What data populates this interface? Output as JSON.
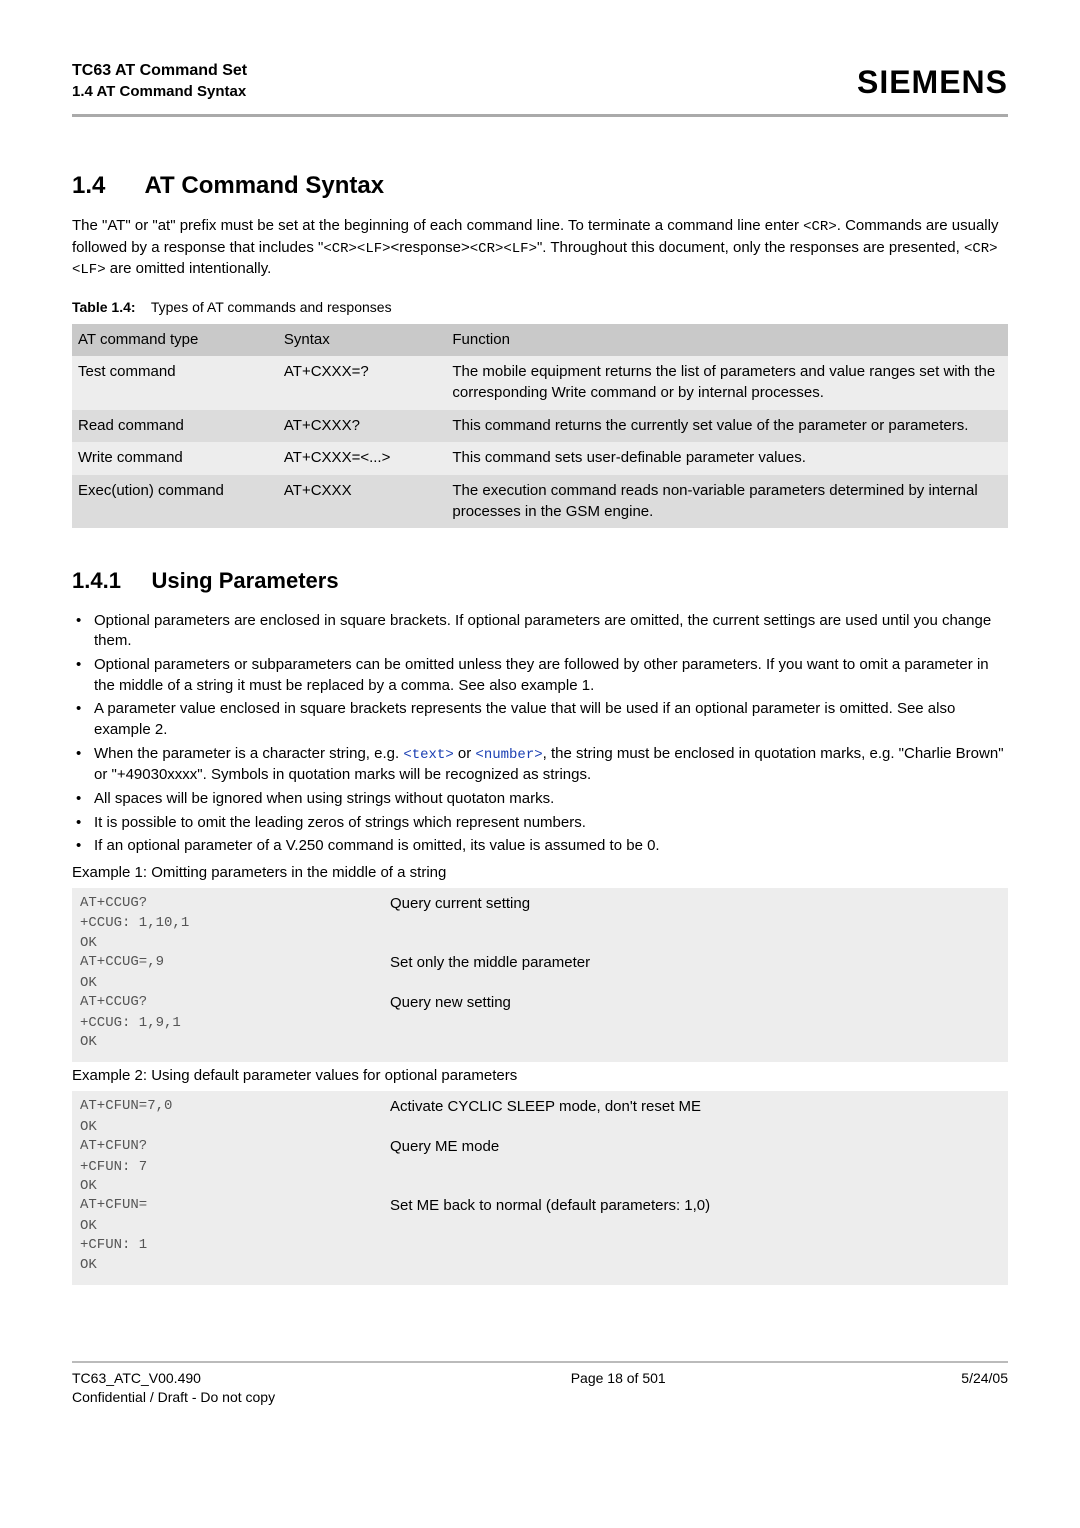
{
  "header": {
    "title": "TC63 AT Command Set",
    "subtitle": "1.4 AT Command Syntax",
    "logo": "SIEMENS"
  },
  "section14": {
    "num": "1.4",
    "title": "AT Command Syntax",
    "intro_part1": "The \"AT\" or \"at\" prefix must be set at the beginning of each command line. To terminate a command line enter ",
    "cr1": "<CR>",
    "intro_part2": ". Commands are usually followed by a response that includes \"",
    "crlf1": "<CR><LF>",
    "resp": "<response>",
    "crlf2": "<CR><LF>",
    "intro_part3": "\". Throughout this document, only the responses are presented, ",
    "crlf3": "<CR><LF>",
    "intro_part4": " are omitted intentionally."
  },
  "table14": {
    "label": "Table 1.4:",
    "caption": "Types of AT commands and responses",
    "headers": [
      "AT command type",
      "Syntax",
      "Function"
    ],
    "rows": [
      {
        "type": "Test command",
        "syntax": "AT+CXXX=?",
        "func": "The mobile equipment returns the list of parameters and value ranges set with the corresponding Write command or by internal processes."
      },
      {
        "type": "Read command",
        "syntax": "AT+CXXX?",
        "func": "This command returns the currently set value of the parameter or parameters."
      },
      {
        "type": "Write command",
        "syntax": "AT+CXXX=<...>",
        "func": "This command sets user-definable parameter values."
      },
      {
        "type": "Exec(ution) command",
        "syntax": "AT+CXXX",
        "func": "The execution command reads non-variable parameters determined by internal processes in the GSM engine."
      }
    ]
  },
  "section141": {
    "num": "1.4.1",
    "title": "Using Parameters",
    "bullets": [
      {
        "text": "Optional parameters are enclosed in square brackets. If optional parameters are omitted, the current settings are used until you change them."
      },
      {
        "text": "Optional parameters or subparameters can be omitted unless they are followed by other parameters. If you want to omit a parameter in the middle of a string it must be replaced by a comma. See also example 1."
      },
      {
        "text": "A parameter value enclosed in square brackets represents the value that will be used if an optional parameter is omitted. See also example 2."
      },
      {
        "pre": "When the parameter is a character string, e.g. ",
        "l1": "<text>",
        "mid": " or ",
        "l2": "<number>",
        "post": ", the string must be enclosed in quotation marks, e.g. \"Charlie Brown\" or \"+49030xxxx\". Symbols in quotation marks will be recognized as strings."
      },
      {
        "text": "All spaces will be ignored when using strings without quotaton marks."
      },
      {
        "text": "It is possible to omit the leading zeros of strings which represent numbers."
      },
      {
        "text": "If an optional parameter of a V.250 command is omitted, its value is assumed to be 0."
      }
    ],
    "ex1_caption": "Example 1: Omitting parameters in the middle of a string",
    "ex1": [
      {
        "l": "AT+CCUG?",
        "r": "Query current setting"
      },
      {
        "l": "+CCUG: 1,10,1",
        "r": ""
      },
      {
        "l": "OK",
        "r": ""
      },
      {
        "l": "AT+CCUG=,9",
        "r": "Set only the middle parameter"
      },
      {
        "l": "OK",
        "r": ""
      },
      {
        "l": "AT+CCUG?",
        "r": "Query new setting"
      },
      {
        "l": "+CCUG: 1,9,1",
        "r": ""
      },
      {
        "l": "OK",
        "r": ""
      }
    ],
    "ex2_caption": "Example 2: Using default parameter values for optional parameters",
    "ex2": [
      {
        "l": "AT+CFUN=7,0",
        "r": "Activate CYCLIC SLEEP mode, don't reset ME"
      },
      {
        "l": "OK",
        "r": ""
      },
      {
        "l": "AT+CFUN?",
        "r": "Query ME mode"
      },
      {
        "l": "+CFUN: 7",
        "r": ""
      },
      {
        "l": "OK",
        "r": ""
      },
      {
        "l": "AT+CFUN=",
        "r": "Set ME back to normal (default parameters: 1,0)"
      },
      {
        "l": "OK",
        "r": ""
      },
      {
        "l": "+CFUN: 1",
        "r": ""
      },
      {
        "l": "OK",
        "r": ""
      }
    ]
  },
  "footer": {
    "left1": "TC63_ATC_V00.490",
    "left2": "Confidential / Draft - Do not copy",
    "center": "Page 18 of 501",
    "right": "5/24/05"
  }
}
